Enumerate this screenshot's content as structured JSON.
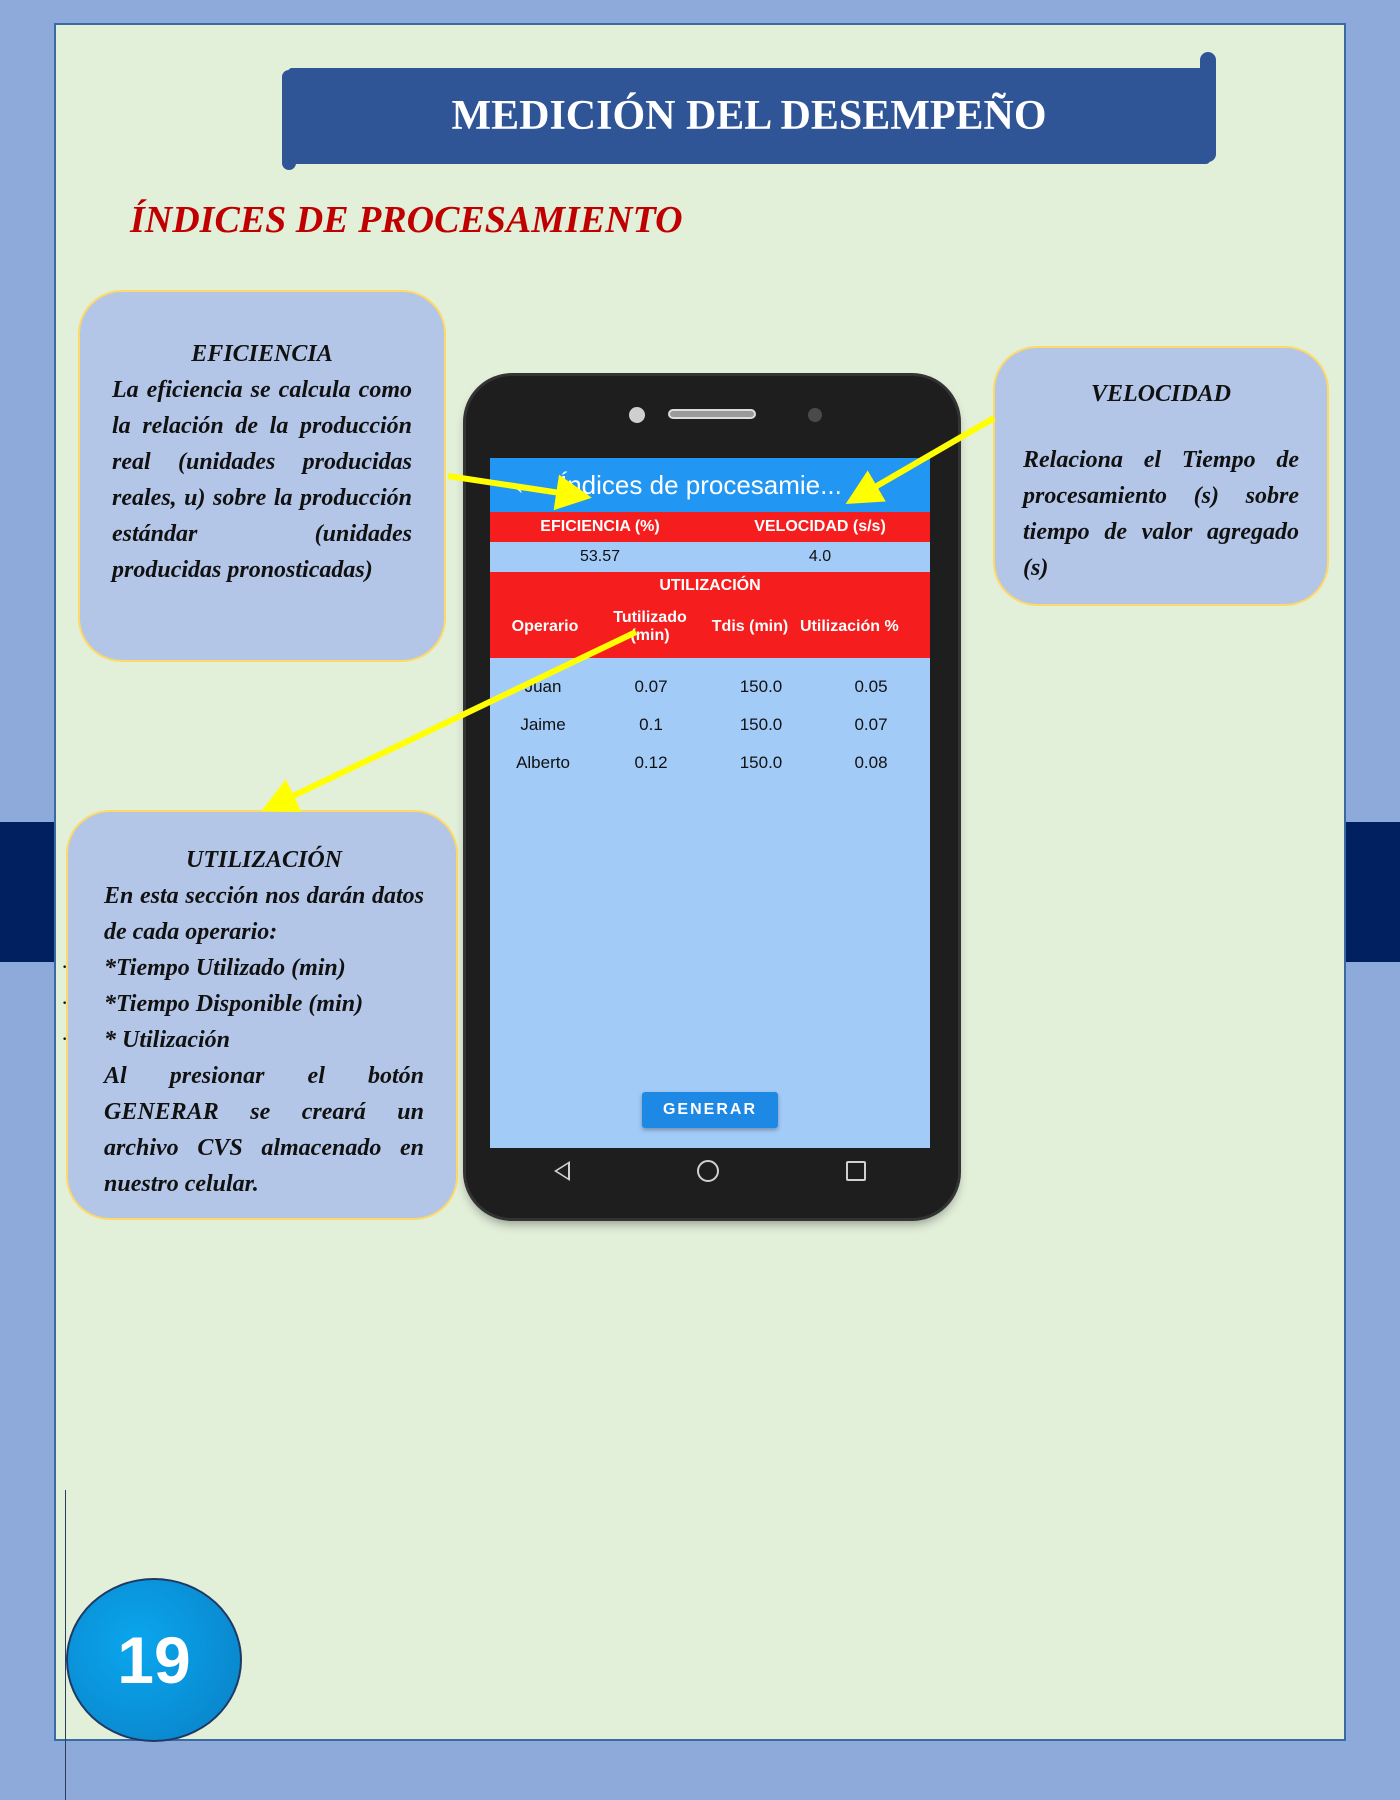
{
  "banner": {
    "title": "MEDICIÓN DEL DESEMPEÑO"
  },
  "section_title": "ÍNDICES DE PROCESAMIENTO",
  "callouts": {
    "eficiencia": {
      "title": "EFICIENCIA",
      "text": "La eficiencia se calcula como la relación de la producción real (unidades producidas reales, u) sobre la producción estándar (unidades producidas pronosticadas)"
    },
    "velocidad": {
      "title": "VELOCIDAD",
      "text": "Relaciona el Tiempo de procesamiento (s) sobre tiempo de valor agregado (s)"
    },
    "utilizacion": {
      "title": "UTILIZACIÓN",
      "intro": "En esta sección nos darán datos de cada operario:",
      "bullets": [
        "*Tiempo Utilizado (min)",
        "*Tiempo Disponible (min)",
        "* Utilización"
      ],
      "bullet_marker": "·",
      "closing": "Al presionar el botón GENERAR se creará un archivo CVS almacenado en nuestro celular."
    }
  },
  "phone": {
    "app_title": "Índices de procesamie...",
    "back_glyph": "←",
    "headers": {
      "eficiencia": "EFICIENCIA (%)",
      "velocidad": "VELOCIDAD (s/s)"
    },
    "values": {
      "eficiencia": "53.57",
      "velocidad": "4.0"
    },
    "utilizacion_title": "UTILIZACIÓN",
    "columns": [
      "Operario",
      "Tutilizado (min)",
      "Tdis (min)",
      "Utilización %"
    ],
    "rows": [
      [
        "Juan",
        "0.07",
        "150.0",
        "0.05"
      ],
      [
        "Jaime",
        "0.1",
        "150.0",
        "0.07"
      ],
      [
        "Alberto",
        "0.12",
        "150.0",
        "0.08"
      ]
    ],
    "generate_label": "GENERAR"
  },
  "page_number": "19",
  "colors": {
    "banner": "#2f5597",
    "accent_red": "#c00000",
    "arrow": "#ffff00",
    "callout_bg": "#b4c6e7"
  }
}
